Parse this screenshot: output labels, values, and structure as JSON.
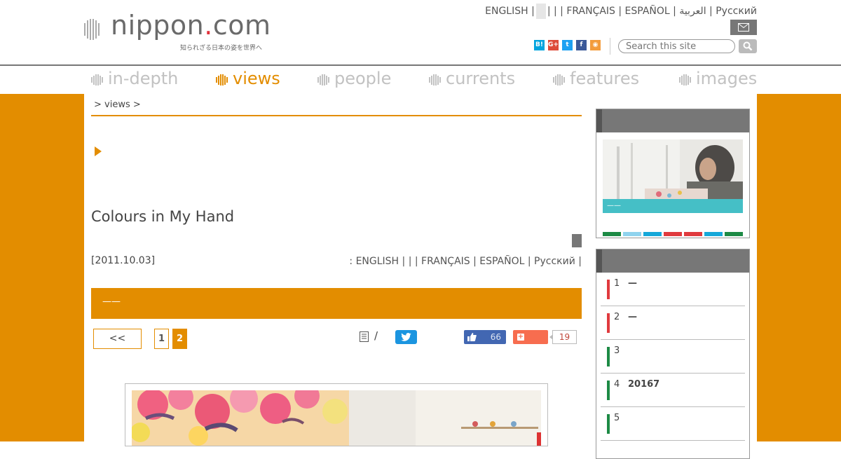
{
  "header": {
    "logo_text": "nippon",
    "logo_dot": ".",
    "logo_suffix": "com",
    "logo_tagline": "知られざる日本の姿を世界へ",
    "languages": "ENGLISH |",
    "languages_rest": "| | | FRANÇAIS | ESPAÑOL | العربية | Русский",
    "search_placeholder": "Search this site"
  },
  "nav": [
    {
      "label": "in-depth",
      "active": false
    },
    {
      "label": "views",
      "active": true
    },
    {
      "label": "people",
      "active": false
    },
    {
      "label": "currents",
      "active": false
    },
    {
      "label": "features",
      "active": false
    },
    {
      "label": "images",
      "active": false
    }
  ],
  "social_icons": [
    {
      "name": "hatena-icon",
      "glyph": "B!",
      "color": "#00a4de"
    },
    {
      "name": "google-plus-icon",
      "glyph": "G+",
      "color": "#dd4b39"
    },
    {
      "name": "twitter-icon",
      "glyph": "t",
      "color": "#1da1f2"
    },
    {
      "name": "facebook-icon",
      "glyph": "f",
      "color": "#3b5998"
    },
    {
      "name": "rss-icon",
      "glyph": "◉",
      "color": "#f39c3c"
    }
  ],
  "article": {
    "breadcrumb": "> views >",
    "title": "Colours in My Hand",
    "date": "[2011.10.03]",
    "languages": ":   ENGLISH |  |  | FRANÇAIS | ESPAÑOL | Русский |",
    "banner_text": "——",
    "prev_label": "<<",
    "pages": [
      "1",
      "2"
    ],
    "current_page": "2",
    "print_separator": "/",
    "like_count": "66",
    "plus_count": "19"
  },
  "sidebar": {
    "feature_caption": "——",
    "color_strip": [
      "#1d8a45",
      "#8fd3ee",
      "#16a8d9",
      "#e03a3e",
      "#e03a3e",
      "#16a8d9",
      "#1d8a45"
    ],
    "ranking": [
      {
        "num": "1",
        "text": "—",
        "color": "#e03a3e"
      },
      {
        "num": "2",
        "text": "—",
        "color": "#e03a3e"
      },
      {
        "num": "3",
        "text": "",
        "color": "#1d8a45"
      },
      {
        "num": "4",
        "text": "20167",
        "color": "#1d8a45"
      },
      {
        "num": "5",
        "text": "",
        "color": "#1d8a45"
      }
    ]
  },
  "colors": {
    "accent": "#e38d00",
    "nav_inactive": "#c2c2c2"
  }
}
